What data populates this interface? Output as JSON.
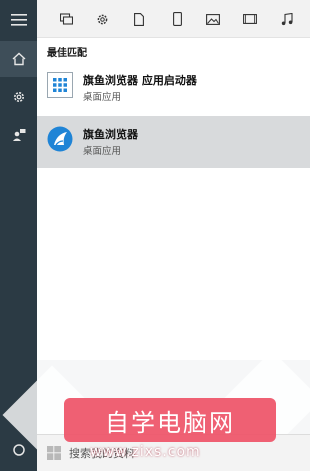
{
  "rail": {
    "items": [
      "menu-icon",
      "home-icon",
      "gear-icon",
      "feedback-icon"
    ],
    "power": "power-icon"
  },
  "filters": [
    "apps-icon",
    "settings-icon",
    "document-icon",
    "phone-icon",
    "photo-icon",
    "video-icon",
    "music-icon"
  ],
  "results": {
    "section_title": "最佳匹配",
    "items": [
      {
        "title": "旗鱼浏览器 应用启动器",
        "subtitle": "桌面应用"
      },
      {
        "title": "旗鱼浏览器",
        "subtitle": "桌面应用"
      }
    ]
  },
  "search": {
    "placeholder": "搜索",
    "value": "",
    "partial_text": "搜索我的资料"
  },
  "watermark": {
    "text": "自学电脑网",
    "url": "www.zixs.com"
  },
  "colors": {
    "rail_bg": "#2b3a44",
    "selected_row": "#d8dadc",
    "app_icon_blue": "#1f84d6",
    "watermark_bg": "#ee5468"
  }
}
